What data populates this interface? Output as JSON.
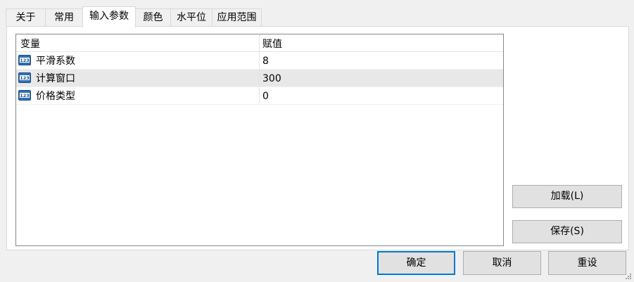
{
  "tabs": [
    {
      "label": "关于"
    },
    {
      "label": "常用"
    },
    {
      "label": "输入参数"
    },
    {
      "label": "颜色"
    },
    {
      "label": "水平位"
    },
    {
      "label": "应用范围"
    }
  ],
  "active_tab": "输入参数",
  "grid": {
    "headers": {
      "variable": "变量",
      "value": "赋值"
    },
    "rows": [
      {
        "icon": "numeric-123-icon",
        "name": "平滑系数",
        "value": "8",
        "selected": false
      },
      {
        "icon": "numeric-123-icon",
        "name": "计算窗口",
        "value": "300",
        "selected": true
      },
      {
        "icon": "numeric-123-icon",
        "name": "价格类型",
        "value": "0",
        "selected": false
      }
    ]
  },
  "side_buttons": {
    "load": "加载(L)",
    "save": "保存(S)"
  },
  "footer_buttons": {
    "ok": "确定",
    "cancel": "取消",
    "reset": "重设"
  },
  "colors": {
    "accent": "#0078d7",
    "selected_row": "#e8e8e8",
    "button_face": "#e1e1e1"
  }
}
